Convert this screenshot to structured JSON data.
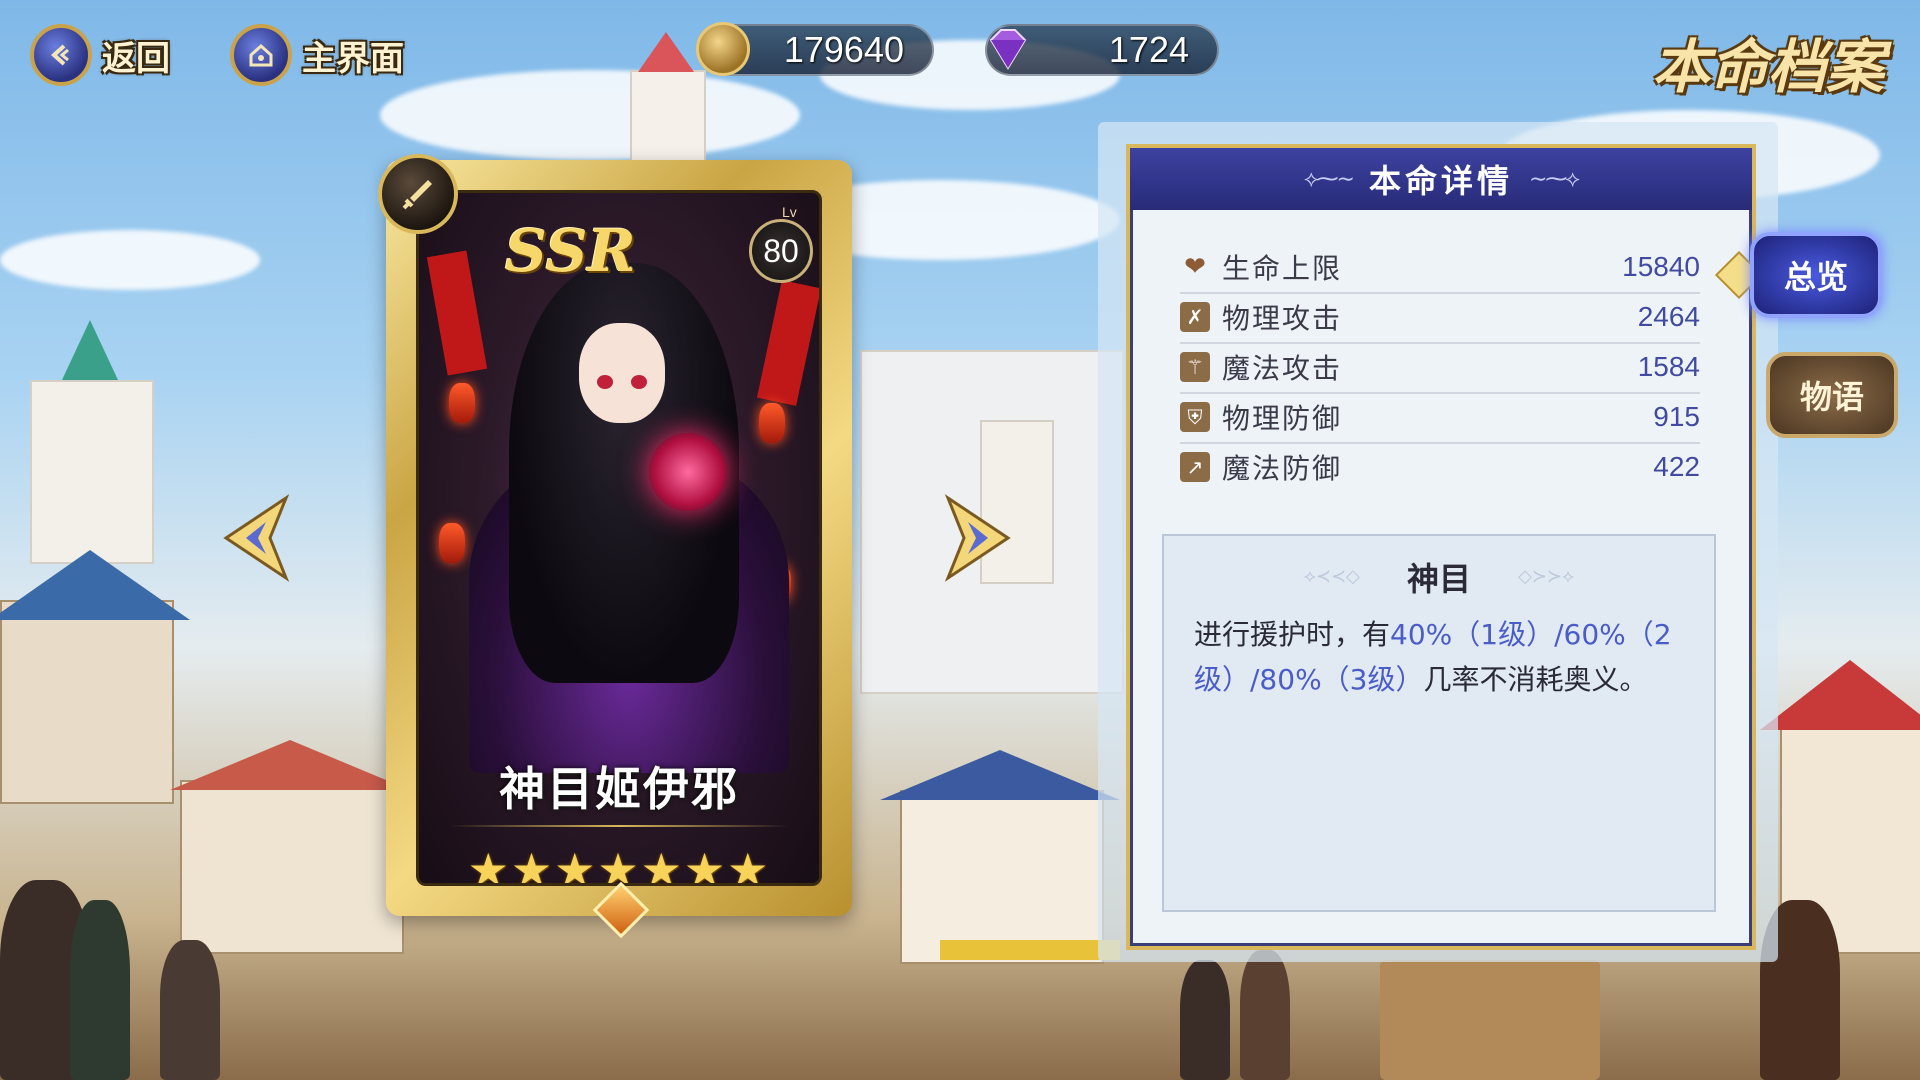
{
  "top_bar": {
    "back_label": "返回",
    "home_label": "主界面",
    "gold_amount": "179640",
    "gem_amount": "1724",
    "page_title": "本命档案"
  },
  "card": {
    "rarity": "SSR",
    "level_prefix": "Lv",
    "level": "80",
    "name": "神目姬伊邪",
    "stars": "★★★★★★★",
    "star_count": 7
  },
  "details": {
    "header": "本命详情",
    "stats": [
      {
        "label": "生命上限",
        "value": "15840",
        "icon": "heart-icon"
      },
      {
        "label": "物理攻击",
        "value": "2464",
        "icon": "crossed-swords-icon"
      },
      {
        "label": "魔法攻击",
        "value": "1584",
        "icon": "magic-wand-icon"
      },
      {
        "label": "物理防御",
        "value": "915",
        "icon": "shield-icon"
      },
      {
        "label": "魔法防御",
        "value": "422",
        "icon": "magic-shield-icon"
      }
    ],
    "skill": {
      "title": "神目",
      "text_1": "进行援护时，有",
      "hl_1": "40%（1级）/60%（2级）/80%（3级）",
      "text_2": "几率不消耗奥义。"
    }
  },
  "side_tabs": {
    "overview_label": "总览",
    "story_label": "物语"
  },
  "colors": {
    "accent_gold": "#d8b85a",
    "header_navy": "#282b78",
    "highlight_blue": "#4a5cc8"
  }
}
